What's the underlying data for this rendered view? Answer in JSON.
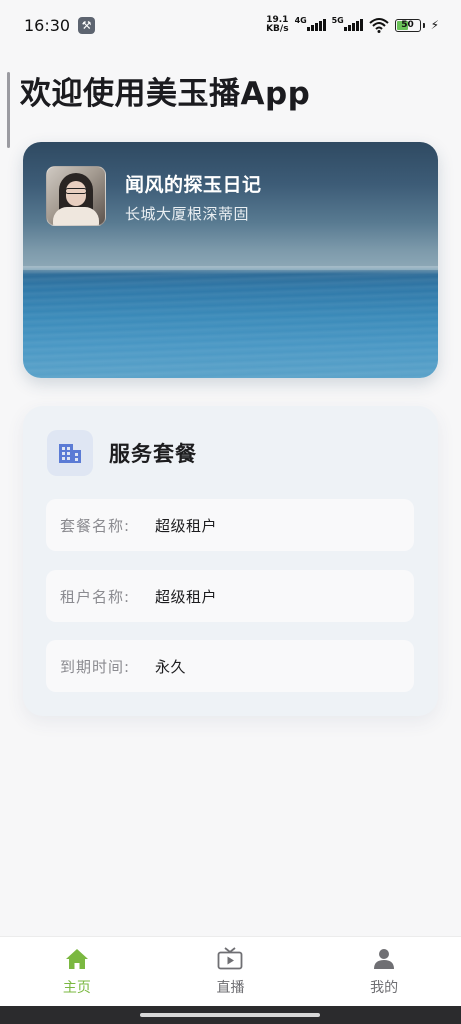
{
  "status_bar": {
    "time": "16:30",
    "net_speed_top": "19.1",
    "net_speed_bottom": "KB/s",
    "sim1_label": "4G",
    "sim2_label": "5G",
    "battery": "50"
  },
  "header": {
    "title": "欢迎使用美玉播App"
  },
  "profile": {
    "name": "闻风的探玉日记",
    "motto": "长城大厦根深蒂固"
  },
  "service": {
    "title": "服务套餐",
    "icon": "building-icon",
    "rows": [
      {
        "label": "套餐名称:",
        "value": "超级租户"
      },
      {
        "label": "租户名称:",
        "value": "超级租户"
      },
      {
        "label": "到期时间:",
        "value": "永久"
      }
    ]
  },
  "bottom_nav": {
    "items": [
      {
        "label": "主页",
        "icon": "home-icon",
        "active": true
      },
      {
        "label": "直播",
        "icon": "tv-icon",
        "active": false
      },
      {
        "label": "我的",
        "icon": "person-icon",
        "active": false
      }
    ]
  },
  "colors": {
    "accent": "#7bb841",
    "background": "#f7f7f8",
    "card": "#eef2f6",
    "icon_blue": "#5b7bd5"
  }
}
